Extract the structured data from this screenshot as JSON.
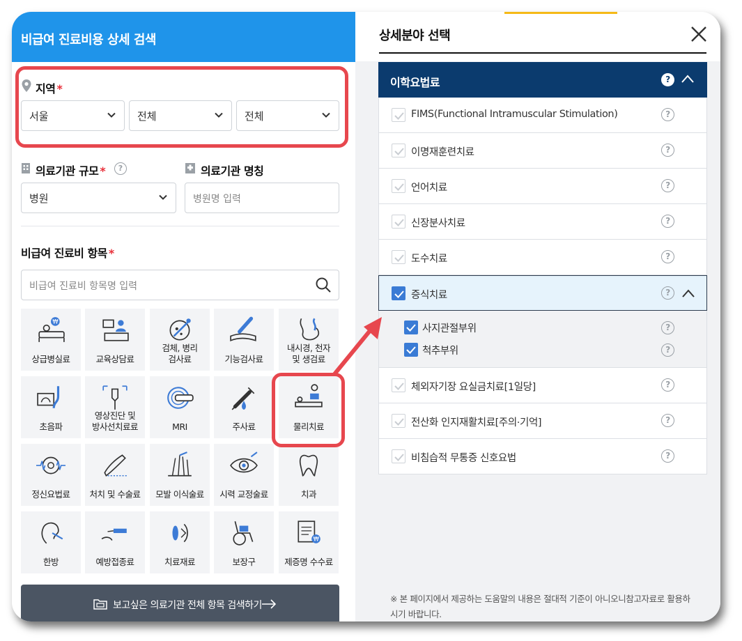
{
  "left": {
    "title": "비급여 진료비용 상세 검색",
    "region": {
      "label": "지역",
      "required_mark": "*",
      "selects": [
        "서울",
        "전체",
        "전체"
      ]
    },
    "institution_size": {
      "label": "의료기관 규모",
      "required_mark": "*",
      "value": "병원"
    },
    "institution_name": {
      "label": "의료기관 명칭",
      "placeholder": "병원명 입력"
    },
    "items": {
      "label": "비급여 진료비 항목",
      "required_mark": "*",
      "search_placeholder": "비급여 진료비 항목명 입력",
      "tiles": [
        [
          "상급병실료"
        ],
        [
          "교육상담료"
        ],
        [
          "검체, 병리",
          "검사료"
        ],
        [
          "기능검사료"
        ],
        [
          "내시경, 천자",
          "및 생검료"
        ],
        [
          "초음파"
        ],
        [
          "영상진단 및",
          "방사선치료료"
        ],
        [
          "MRI"
        ],
        [
          "주사료"
        ],
        [
          "물리치료"
        ],
        [
          "정신요법료"
        ],
        [
          "처치 및 수술료"
        ],
        [
          "모발 이식술료"
        ],
        [
          "시력 교정술료"
        ],
        [
          "치과"
        ],
        [
          "한방"
        ],
        [
          "예방접종료"
        ],
        [
          "치료재료"
        ],
        [
          "보장구"
        ],
        [
          "제증명 수수료"
        ]
      ],
      "icons": [
        "bed-icon",
        "counseling-icon",
        "specimen-icon",
        "arm-test-icon",
        "endoscope-icon",
        "ultrasound-icon",
        "xray-icon",
        "mri-icon",
        "syringe-icon",
        "physical-therapy-icon",
        "brain-wave-icon",
        "surgery-icon",
        "hair-transplant-icon",
        "eye-icon",
        "tooth-icon",
        "acupuncture-ear-icon",
        "vaccine-icon",
        "lens-icon",
        "wheelchair-icon",
        "certificate-icon"
      ]
    },
    "search_all_button": "보고싶은 의료기관 전체 항목 검색하기"
  },
  "right": {
    "title": "상세분야 선택",
    "category": "이학요법료",
    "rows": [
      "FIMS(Functional Intramuscular Stimulation)",
      "이명재훈련치료",
      "언어치료",
      "신장분사치료",
      "도수치료",
      "증식치료"
    ],
    "sub_rows": [
      "사지관절부위",
      "척추부위"
    ],
    "rows_after": [
      "체외자기장 요실금치료[1일당]",
      "전산화 인지재활치료[주의·기억]",
      "비침습적 무통증 신호요법"
    ],
    "help_glyph": "?",
    "note": "※ 본 페이지에서 제공하는 도움말의 내용은 절대적 기준이 아니오니참고자료로 활용하시기 바랍니다."
  },
  "colors": {
    "header_blue": "#1f94ea",
    "category_navy": "#0b3b6e",
    "highlight_red": "#e7474e",
    "check_blue": "#3a7bd5"
  }
}
